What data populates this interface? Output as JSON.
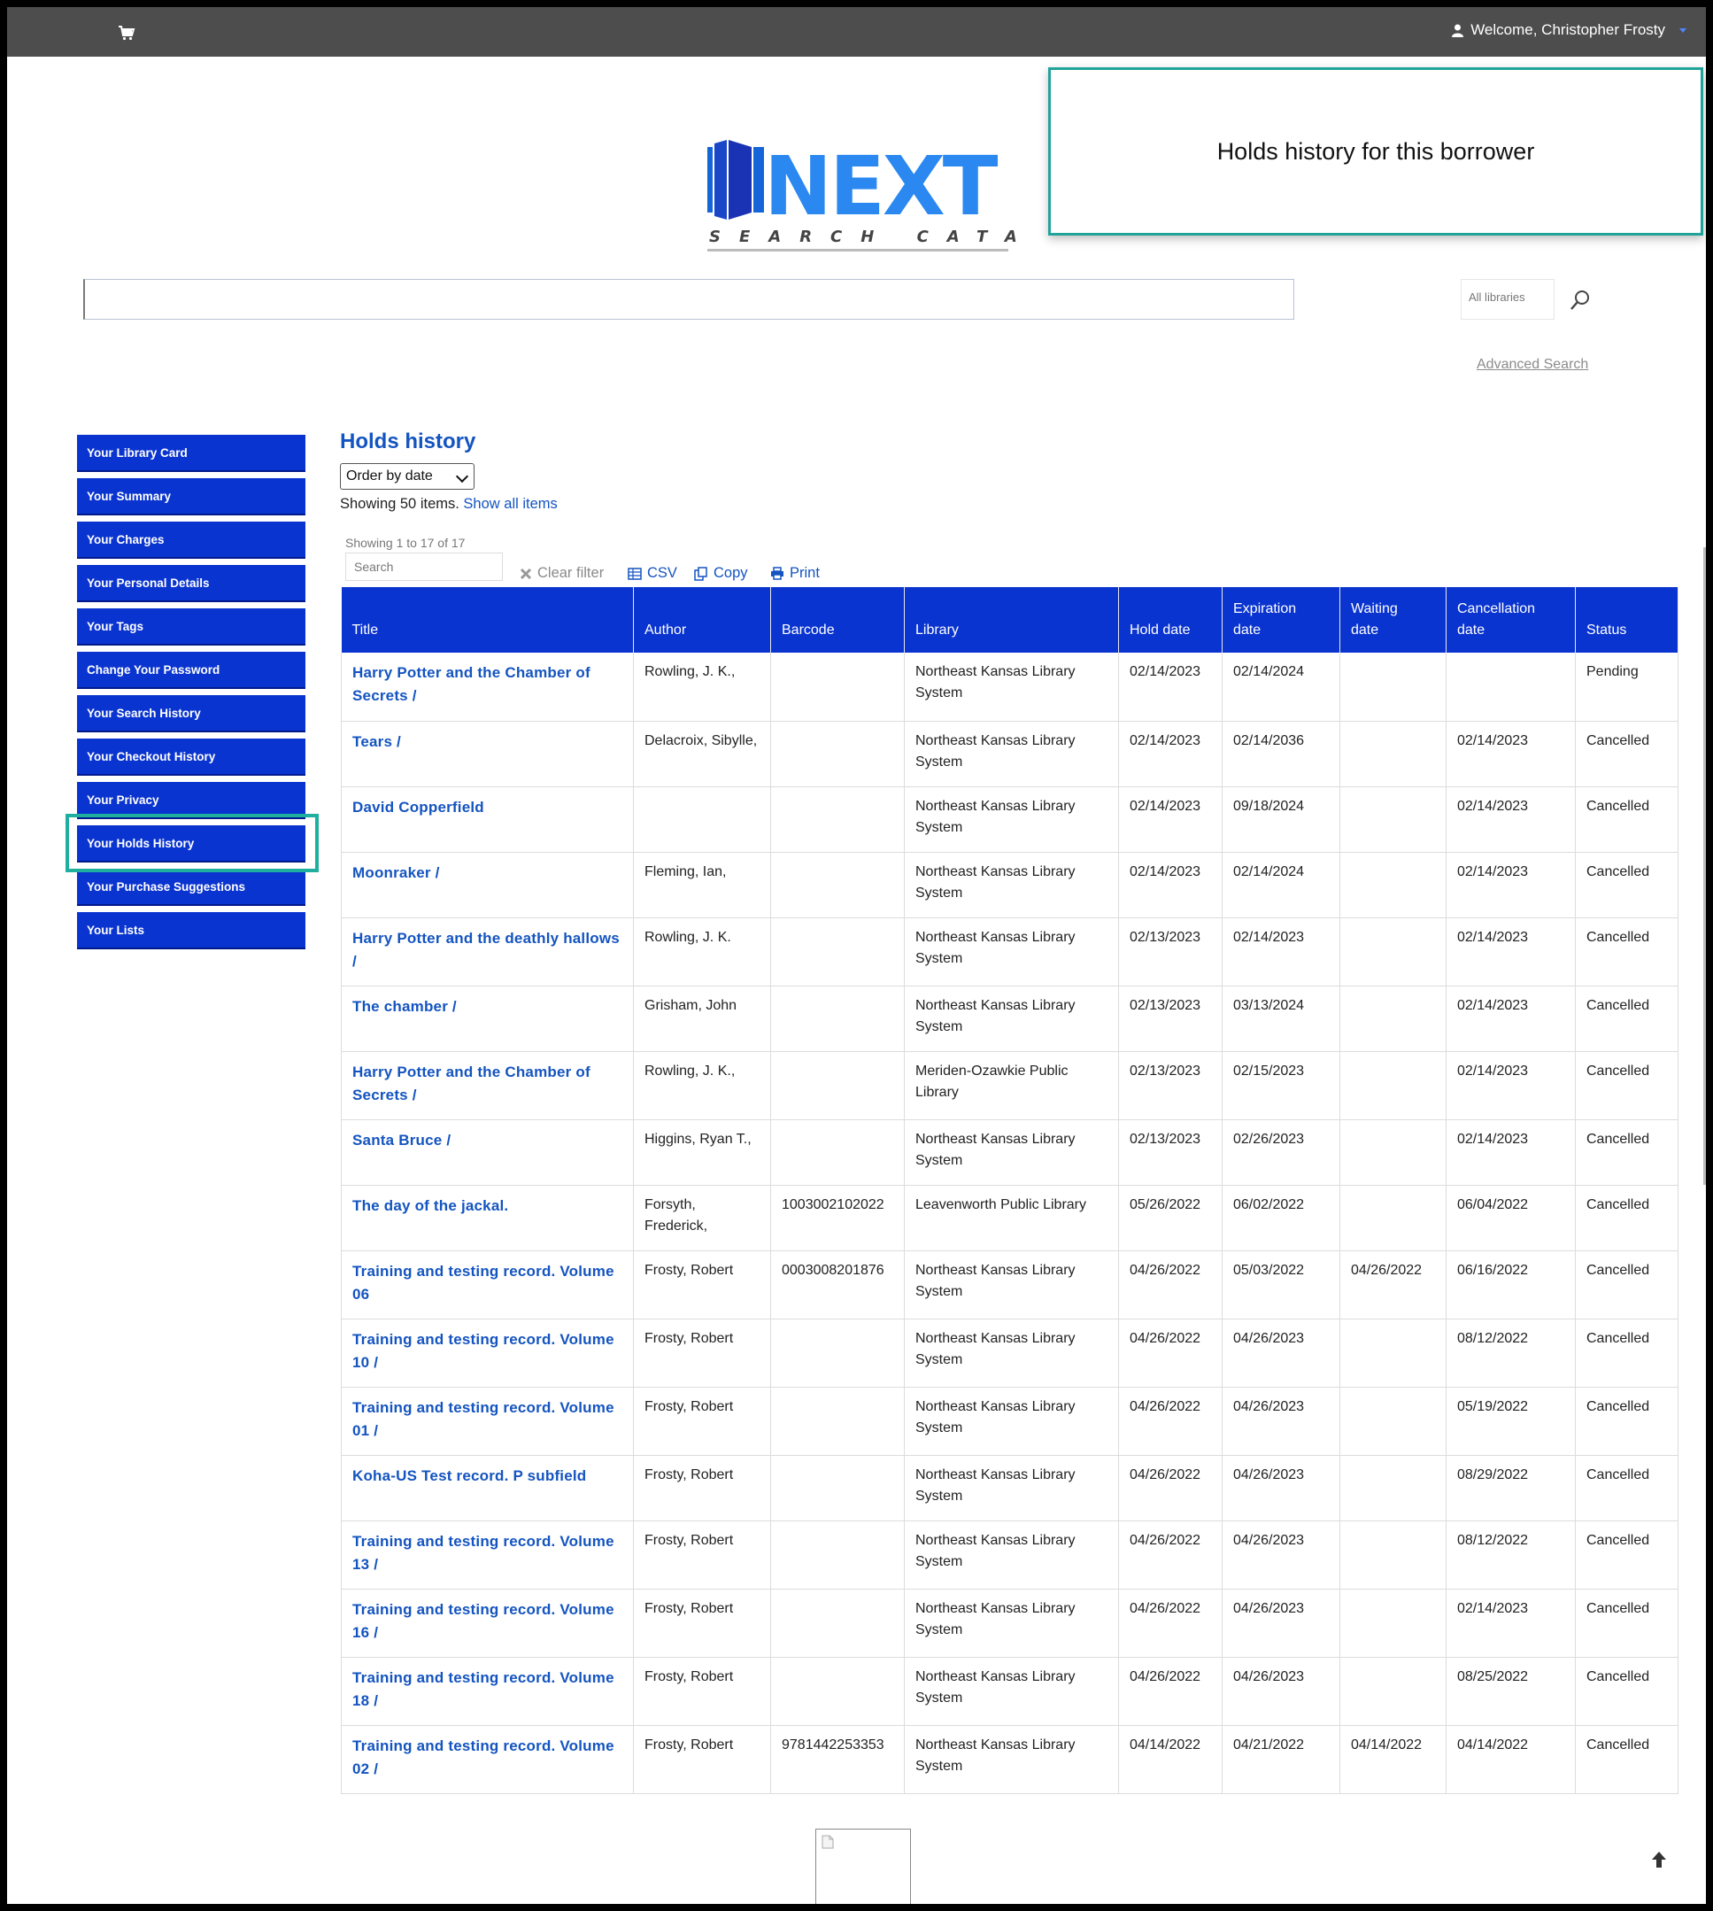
{
  "header": {
    "welcome_text": "Welcome, Christopher Frosty",
    "cart_icon": "cart-icon",
    "user_icon": "user-icon"
  },
  "logo": {
    "word": "NEXT",
    "tagline": "SEARCH CATALOG"
  },
  "callout": {
    "text": "Holds history for this borrower"
  },
  "search": {
    "query": "",
    "branch_selected": "All libraries",
    "advanced_link": "Advanced Search"
  },
  "sidebar": {
    "items": [
      {
        "label": "Your Library Card"
      },
      {
        "label": "Your Summary"
      },
      {
        "label": "Your Charges"
      },
      {
        "label": "Your Personal Details"
      },
      {
        "label": "Your Tags"
      },
      {
        "label": "Change Your Password"
      },
      {
        "label": "Your Search History"
      },
      {
        "label": "Your Checkout History"
      },
      {
        "label": "Your Privacy"
      },
      {
        "label": "Your Holds History",
        "active": true
      },
      {
        "label": "Your Purchase Suggestions"
      },
      {
        "label": "Your Lists"
      }
    ]
  },
  "main": {
    "title": "Holds history",
    "order_select": "Order by date",
    "showing_text": "Showing 50 items.",
    "show_all_link": "Show all items",
    "count_text": "Showing 1 to 17 of 17",
    "filter_placeholder": "Search",
    "clear_filter": "Clear filter",
    "csv": "CSV",
    "copy": "Copy",
    "print": "Print"
  },
  "table": {
    "columns": [
      {
        "top": "",
        "bottom": "Title"
      },
      {
        "top": "",
        "bottom": "Author"
      },
      {
        "top": "",
        "bottom": "Barcode"
      },
      {
        "top": "",
        "bottom": "Library"
      },
      {
        "top": "",
        "bottom": "Hold date"
      },
      {
        "top": "Expiration",
        "bottom": "date"
      },
      {
        "top": "Waiting",
        "bottom": "date"
      },
      {
        "top": "Cancellation",
        "bottom": "date"
      },
      {
        "top": "",
        "bottom": "Status"
      }
    ],
    "rows": [
      {
        "title": "Harry Potter and the Chamber of Secrets /",
        "author": "Rowling, J. K.,",
        "barcode": "",
        "library": "Northeast Kansas Library System",
        "hold_date": "02/14/2023",
        "expiration": "02/14/2024",
        "waiting": "",
        "cancellation": "",
        "status": "Pending"
      },
      {
        "title": "Tears /",
        "author": "Delacroix, Sibylle,",
        "barcode": "",
        "library": "Northeast Kansas Library System",
        "hold_date": "02/14/2023",
        "expiration": "02/14/2036",
        "waiting": "",
        "cancellation": "02/14/2023",
        "status": "Cancelled"
      },
      {
        "title": "David Copperfield",
        "author": "",
        "barcode": "",
        "library": "Northeast Kansas Library System",
        "hold_date": "02/14/2023",
        "expiration": "09/18/2024",
        "waiting": "",
        "cancellation": "02/14/2023",
        "status": "Cancelled"
      },
      {
        "title": "Moonraker /",
        "author": "Fleming, Ian,",
        "barcode": "",
        "library": "Northeast Kansas Library System",
        "hold_date": "02/14/2023",
        "expiration": "02/14/2024",
        "waiting": "",
        "cancellation": "02/14/2023",
        "status": "Cancelled"
      },
      {
        "title": "Harry Potter and the deathly hallows /",
        "author": "Rowling, J. K.",
        "barcode": "",
        "library": "Northeast Kansas Library System",
        "hold_date": "02/13/2023",
        "expiration": "02/14/2023",
        "waiting": "",
        "cancellation": "02/14/2023",
        "status": "Cancelled"
      },
      {
        "title": "The chamber /",
        "author": "Grisham, John",
        "barcode": "",
        "library": "Northeast Kansas Library System",
        "hold_date": "02/13/2023",
        "expiration": "03/13/2024",
        "waiting": "",
        "cancellation": "02/14/2023",
        "status": "Cancelled"
      },
      {
        "title": "Harry Potter and the Chamber of Secrets /",
        "author": "Rowling, J. K.,",
        "barcode": "",
        "library": "Meriden-Ozawkie Public Library",
        "hold_date": "02/13/2023",
        "expiration": "02/15/2023",
        "waiting": "",
        "cancellation": "02/14/2023",
        "status": "Cancelled"
      },
      {
        "title": "Santa Bruce /",
        "author": "Higgins, Ryan T.,",
        "barcode": "",
        "library": "Northeast Kansas Library System",
        "hold_date": "02/13/2023",
        "expiration": "02/26/2023",
        "waiting": "",
        "cancellation": "02/14/2023",
        "status": "Cancelled"
      },
      {
        "title": "The day of the jackal.",
        "author": "Forsyth, Frederick,",
        "barcode": "1003002102022",
        "library": "Leavenworth Public Library",
        "hold_date": "05/26/2022",
        "expiration": "06/02/2022",
        "waiting": "",
        "cancellation": "06/04/2022",
        "status": "Cancelled"
      },
      {
        "title": "Training and testing record. Volume 06",
        "author": "Frosty, Robert",
        "barcode": "0003008201876",
        "library": "Northeast Kansas Library System",
        "hold_date": "04/26/2022",
        "expiration": "05/03/2022",
        "waiting": "04/26/2022",
        "cancellation": "06/16/2022",
        "status": "Cancelled"
      },
      {
        "title": "Training and testing record. Volume 10 /",
        "author": "Frosty, Robert",
        "barcode": "",
        "library": "Northeast Kansas Library System",
        "hold_date": "04/26/2022",
        "expiration": "04/26/2023",
        "waiting": "",
        "cancellation": "08/12/2022",
        "status": "Cancelled"
      },
      {
        "title": "Training and testing record. Volume 01 /",
        "author": "Frosty, Robert",
        "barcode": "",
        "library": "Northeast Kansas Library System",
        "hold_date": "04/26/2022",
        "expiration": "04/26/2023",
        "waiting": "",
        "cancellation": "05/19/2022",
        "status": "Cancelled"
      },
      {
        "title": "Koha-US Test record. P subfield",
        "author": "Frosty, Robert",
        "barcode": "",
        "library": "Northeast Kansas Library System",
        "hold_date": "04/26/2022",
        "expiration": "04/26/2023",
        "waiting": "",
        "cancellation": "08/29/2022",
        "status": "Cancelled"
      },
      {
        "title": "Training and testing record. Volume 13 /",
        "author": "Frosty, Robert",
        "barcode": "",
        "library": "Northeast Kansas Library System",
        "hold_date": "04/26/2022",
        "expiration": "04/26/2023",
        "waiting": "",
        "cancellation": "08/12/2022",
        "status": "Cancelled"
      },
      {
        "title": "Training and testing record. Volume 16 /",
        "author": "Frosty, Robert",
        "barcode": "",
        "library": "Northeast Kansas Library System",
        "hold_date": "04/26/2022",
        "expiration": "04/26/2023",
        "waiting": "",
        "cancellation": "02/14/2023",
        "status": "Cancelled"
      },
      {
        "title": "Training and testing record. Volume 18 /",
        "author": "Frosty, Robert",
        "barcode": "",
        "library": "Northeast Kansas Library System",
        "hold_date": "04/26/2022",
        "expiration": "04/26/2023",
        "waiting": "",
        "cancellation": "08/25/2022",
        "status": "Cancelled"
      },
      {
        "title": "Training and testing record. Volume 02 /",
        "author": "Frosty, Robert",
        "barcode": "9781442253353",
        "library": "Northeast Kansas Library System",
        "hold_date": "04/14/2022",
        "expiration": "04/21/2022",
        "waiting": "04/14/2022",
        "cancellation": "04/14/2022",
        "status": "Cancelled"
      }
    ]
  },
  "colors": {
    "topbar": "#4d4d4d",
    "nav_blue": "#0a34cf",
    "link_blue": "#1454c0",
    "highlight_teal": "#1faf9f"
  }
}
